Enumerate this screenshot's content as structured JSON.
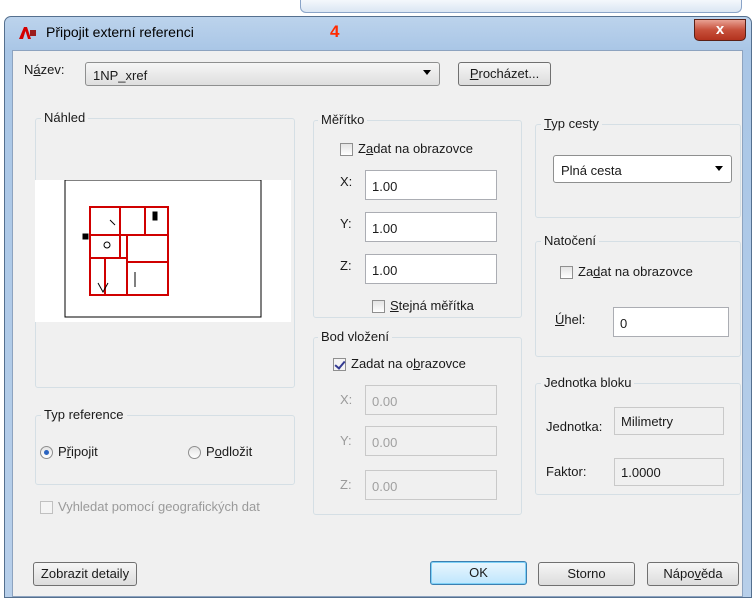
{
  "window": {
    "title": "Připojit externí referenci",
    "marker": "4",
    "close_glyph": "x"
  },
  "name_row": {
    "label_pre": "N",
    "label_acc": "á",
    "label_post": "zev:",
    "value": "1NP_xref",
    "browse_acc": "P",
    "browse_post": "rocházet..."
  },
  "preview": {
    "label": "Náhled"
  },
  "scale": {
    "label": "Měřítko",
    "onscreen_pre": "Z",
    "onscreen_acc": "a",
    "onscreen_post": "dat na obrazovce",
    "x_label": "X:",
    "y_label": "Y:",
    "z_label": "Z:",
    "x": "1.00",
    "y": "1.00",
    "z": "1.00",
    "uniform_acc": "S",
    "uniform_post": "tejná měřítka"
  },
  "insertion": {
    "label": "Bod vložení",
    "onscreen_pre": "Zadat na o",
    "onscreen_acc": "b",
    "onscreen_post": "razovce",
    "x_label": "X:",
    "y_label": "Y:",
    "z_label": "Z:",
    "x": "0.00",
    "y": "0.00",
    "z": "0.00"
  },
  "path_type": {
    "label_acc": "T",
    "label_post": "yp cesty",
    "value": "Plná cesta"
  },
  "rotation": {
    "label": "Natočení",
    "onscreen_pre": "Za",
    "onscreen_acc": "d",
    "onscreen_post": "at na obrazovce",
    "angle_acc": "Ú",
    "angle_post": "hel:",
    "angle": "0"
  },
  "block_unit": {
    "label": "Jednotka bloku",
    "unit_label": "Jednotka:",
    "unit": "Milimetry",
    "factor_label": "Faktor:",
    "factor": "1.0000"
  },
  "ref_type": {
    "label": "Typ reference",
    "attach_pre": "P",
    "attach_acc": "ř",
    "attach_post": "ipojit",
    "overlay_pre": "P",
    "overlay_acc": "o",
    "overlay_post": "dložit"
  },
  "geo": {
    "label_pre": "Vyhledat pomocí ",
    "label_acc": "g",
    "label_post": "eografických dat"
  },
  "buttons": {
    "details": "Zobrazit detaily",
    "ok": "OK",
    "cancel": "Storno",
    "help_pre": "Nápo",
    "help_acc": "v",
    "help_post": "ěda"
  },
  "colors": {
    "title_marker": "#ff2a00",
    "drawing_lines": "#d00000",
    "close": "#c7503b"
  }
}
